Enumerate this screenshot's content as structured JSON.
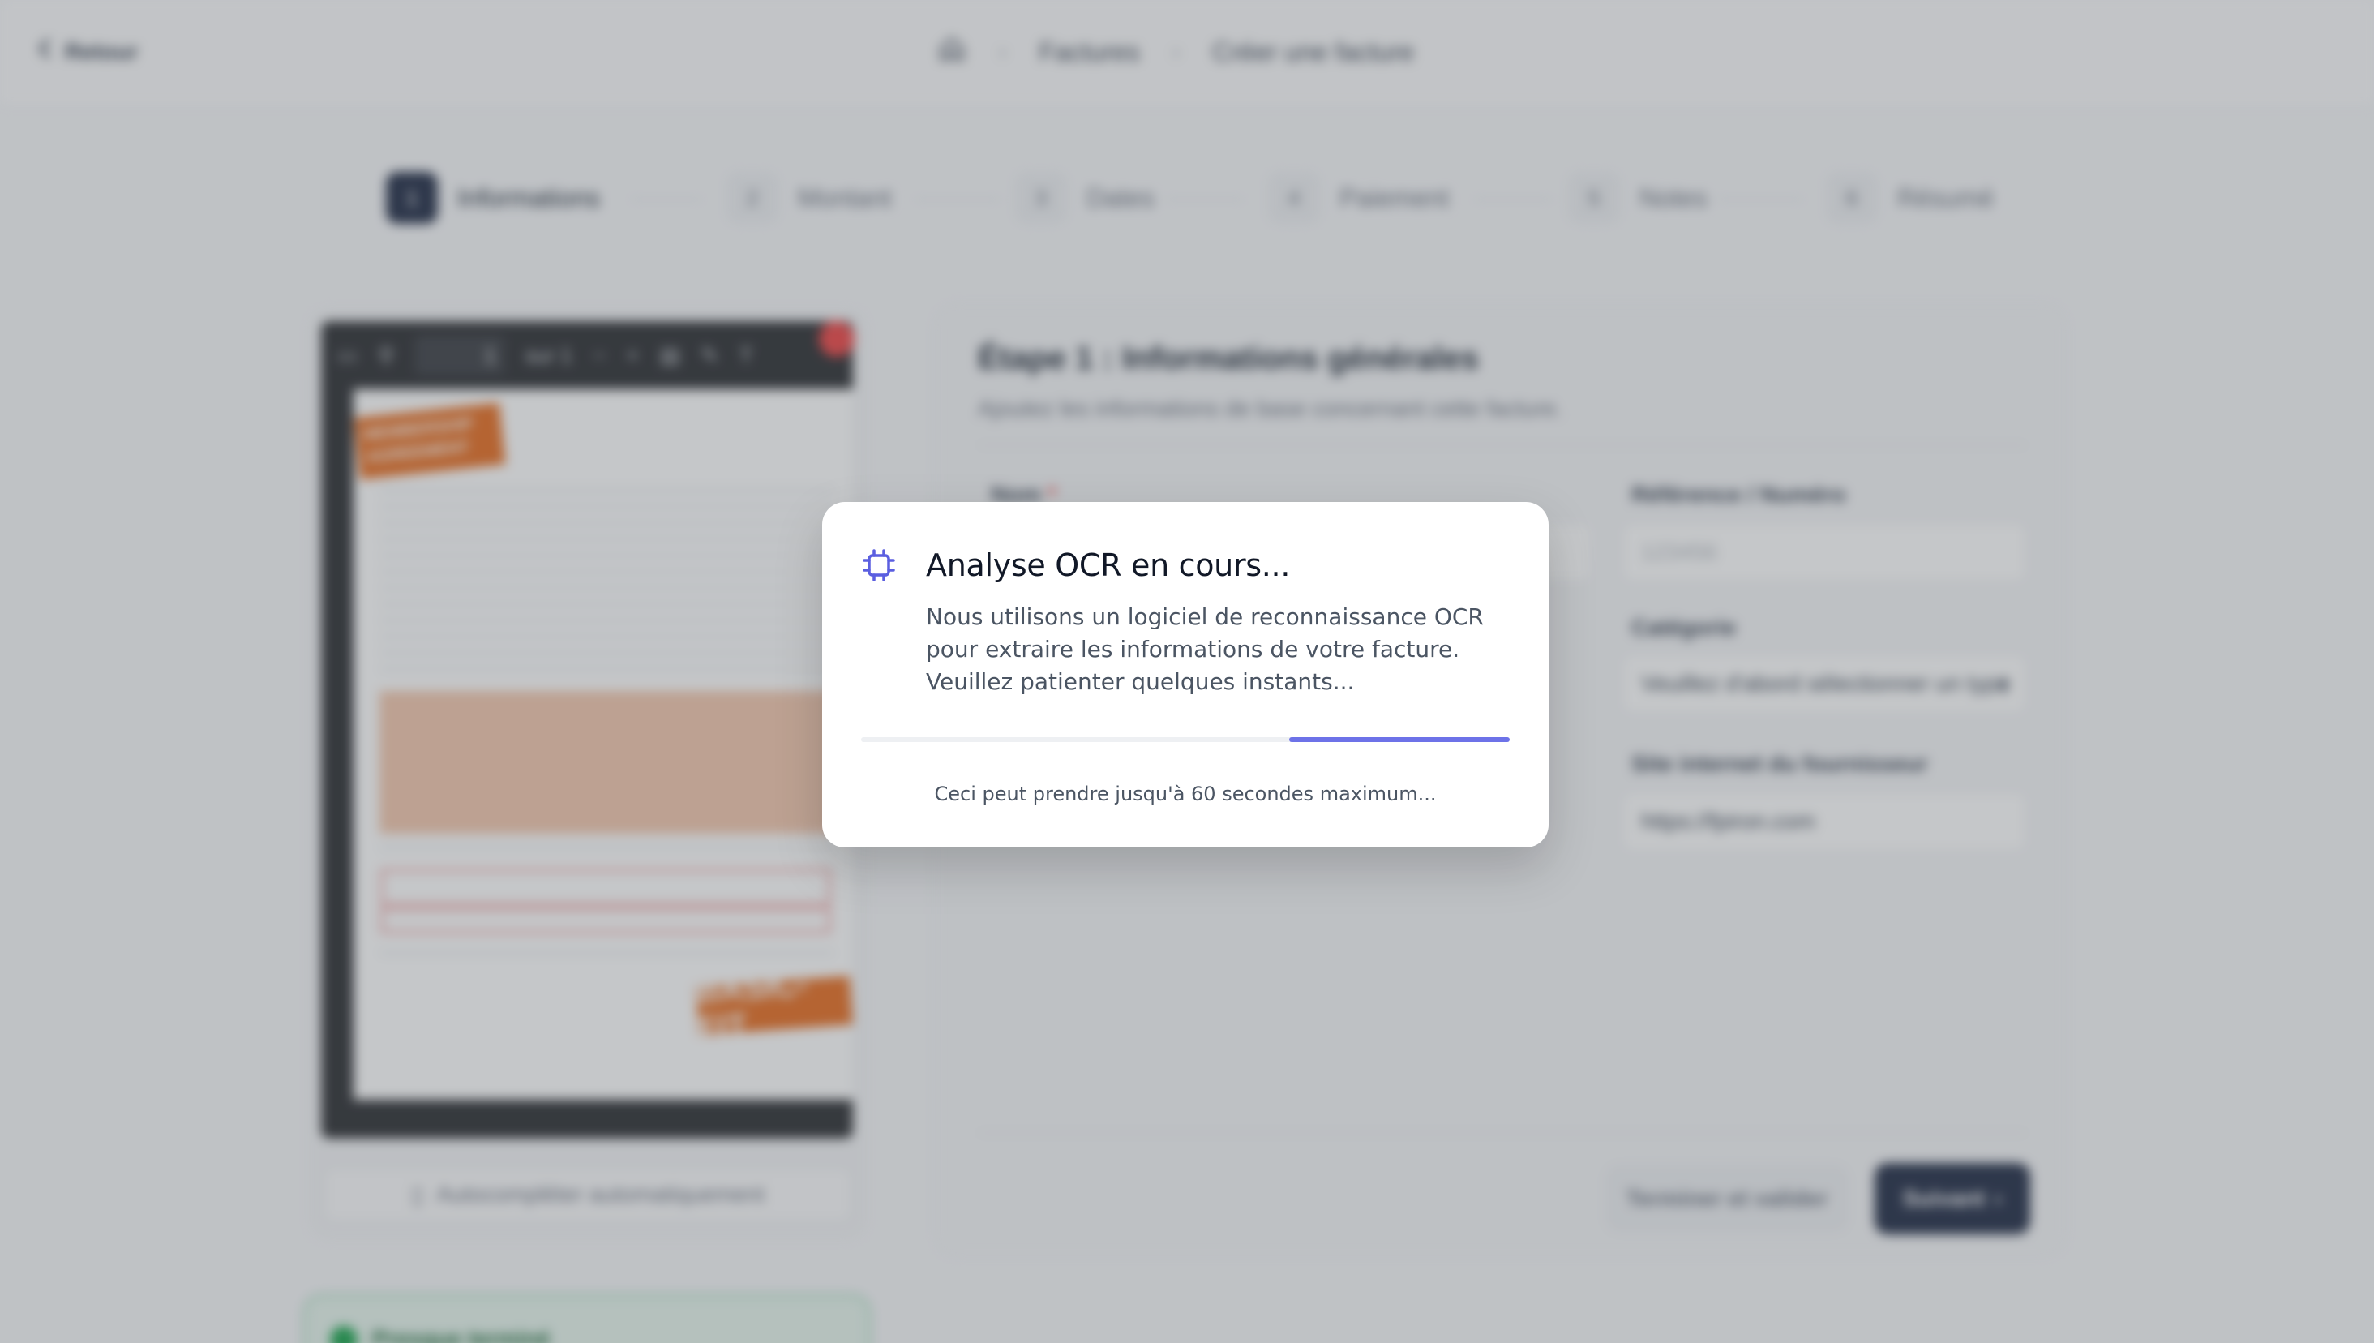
{
  "header": {
    "back_label": "Retour",
    "breadcrumb": [
      "Factures",
      "Créer une facture"
    ]
  },
  "stepper": {
    "active_index": 0,
    "steps": [
      {
        "number": "1",
        "label": "Informations"
      },
      {
        "number": "2",
        "label": "Montant"
      },
      {
        "number": "3",
        "label": "Dates"
      },
      {
        "number": "4",
        "label": "Paiement"
      },
      {
        "number": "5",
        "label": "Notes"
      },
      {
        "number": "6",
        "label": "Résumé"
      }
    ]
  },
  "viewer": {
    "page_value": "1",
    "page_total": "sur 1",
    "document": {
      "banner_text": "MEMBERSHIP AGREEMENT",
      "logo_text": "BASIC-FIT"
    },
    "autocomplete_label": "Autocompléter automatiquement"
  },
  "status_card": {
    "label": "Presque terminé"
  },
  "form": {
    "title": "Étape 1 : Informations générales",
    "subtitle": "Ajoutez les informations de base concernant cette facture.",
    "name_label": "Nom",
    "name_required_mark": "*",
    "reference_label": "Référence / Numéro",
    "reference_placeholder": "123456",
    "category_label": "Catégorie",
    "category_value": "Veuillez d'abord sélectionner un type",
    "website_label": "Site internet du fournisseur",
    "website_value": "https://fpiron.com",
    "finish_button": "Terminer et valider",
    "next_button": "Suivant"
  },
  "modal": {
    "icon": "cpu-chip-icon",
    "title": "Analyse OCR en cours...",
    "description": "Nous utilisons un logiciel de reconnaissance OCR pour extraire les informations de votre facture. Veuillez patienter quelques instants...",
    "progress_fill_start": 0.66,
    "progress_fill_end": 1.0,
    "note": "Ceci peut prendre jusqu'à 60 secondes maximum..."
  },
  "colors": {
    "accent": "#6d72e8",
    "primary_dark": "#1f2a44",
    "error": "#ef4444"
  }
}
